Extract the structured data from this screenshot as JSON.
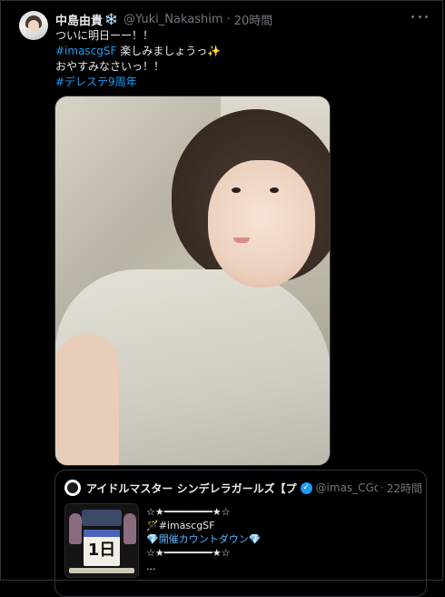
{
  "tweet": {
    "author_name": "中島由貴",
    "author_badge": "❄️",
    "handle": "@Yuki_Nakashim",
    "separator": "·",
    "time": "20時間",
    "lines": [
      {
        "text": "ついに明日ーー！！"
      },
      {
        "tag": "#imascgSF",
        "text": " 楽しみましょうっ✨"
      },
      {
        "text": "おやすみなさいっ！！"
      },
      {
        "tag": "#デレステ9周年"
      }
    ]
  },
  "quoted_tweet": {
    "author_name": "アイドルマスター シンデレラガールズ【プラ",
    "verified_mark": "✓",
    "handle": "@imas_CGo",
    "separator": "·",
    "time": "22時間",
    "thumb_number": "1日",
    "lines": [
      "☆★━━━━━━━━★☆",
      "🪄#imascgSF",
      "💎開催カウントダウン💎",
      "☆★━━━━━━━━★☆",
      "..."
    ]
  },
  "colors": {
    "background": "#000000",
    "text": "#e7e9ea",
    "muted": "#71767b",
    "link": "#1d9bf0",
    "border": "#2f3336"
  },
  "icons": [
    "avatar",
    "more-icon",
    "verified-icon",
    "photo",
    "thumbnail"
  ]
}
